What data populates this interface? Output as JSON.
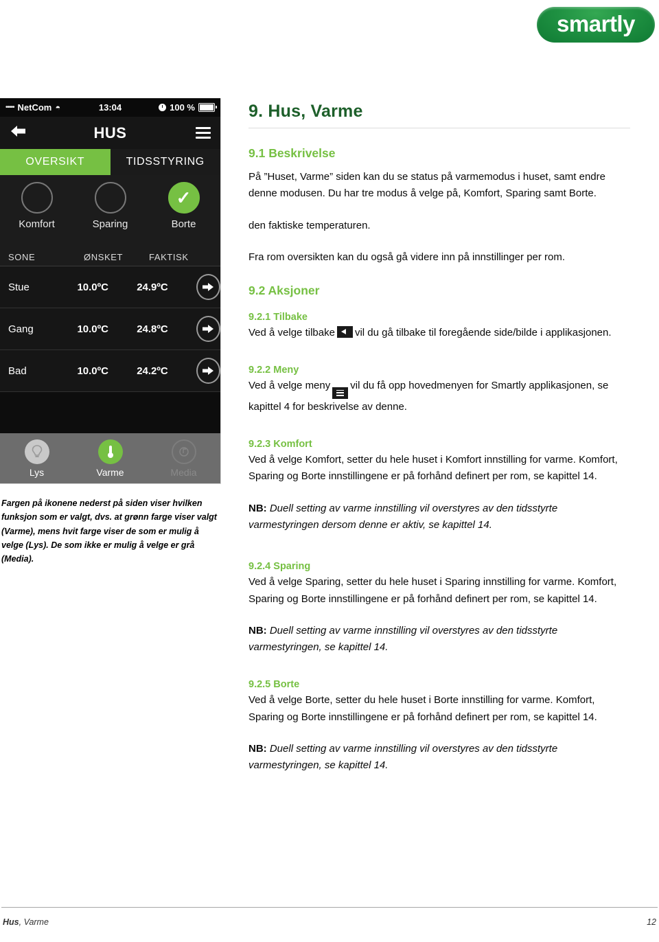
{
  "brand": {
    "logo_text": "smartly",
    "green": "#76c043",
    "dark_green": "#1d5f2a"
  },
  "phone": {
    "statusbar": {
      "carrier": "NetCom",
      "signal_dots": "•••••",
      "wifi_icon": "wifi-icon",
      "time": "13:04",
      "battery_percent": "100 %",
      "alarm_icon": "clock-icon"
    },
    "navbar": {
      "title": "HUS",
      "back_icon": "back-arrow-icon",
      "menu_icon": "hamburger-menu-icon"
    },
    "tabs": [
      {
        "label": "OVERSIKT",
        "active": true
      },
      {
        "label": "TIDSSTYRING",
        "active": false
      }
    ],
    "modes": [
      {
        "label": "Komfort",
        "selected": false
      },
      {
        "label": "Sparing",
        "selected": false
      },
      {
        "label": "Borte",
        "selected": true
      }
    ],
    "table": {
      "headers": [
        "SONE",
        "ØNSKET",
        "FAKTISK"
      ],
      "rows": [
        {
          "zone": "Stue",
          "desired": "10.0ºC",
          "actual": "24.9ºC"
        },
        {
          "zone": "Gang",
          "desired": "10.0ºC",
          "actual": "24.8ºC"
        },
        {
          "zone": "Bad",
          "desired": "10.0ºC",
          "actual": "24.2ºC"
        }
      ]
    },
    "tabbar": [
      {
        "label": "Lys",
        "icon": "lightbulb-icon",
        "state": "available"
      },
      {
        "label": "Varme",
        "icon": "thermometer-icon",
        "state": "selected"
      },
      {
        "label": "Media",
        "icon": "media-icon",
        "state": "disabled"
      }
    ]
  },
  "caption": "Fargen på ikonene nederst på siden viser hvilken funksjon som er valgt, dvs. at grønn farge viser valgt (Varme), mens hvit farge viser de som er mulig å velge (Lys). De som ikke er mulig å velge er grå (Media).",
  "doc": {
    "title": "9.  Hus, Varme",
    "s91": {
      "heading": "9.1  Beskrivelse",
      "p1": "På ”Huset, Varme” siden kan du se status på varmemodus i huset, samt endre denne modusen. Du har tre modus å velge på, Komfort, Sparing samt Borte.",
      "p2": "den faktiske temperaturen.",
      "p3": "Fra rom oversikten kan du også gå videre inn på innstillinger per rom."
    },
    "s92": {
      "heading": "9.2  Aksjoner",
      "tilbake": {
        "heading": "9.2.1  Tilbake",
        "text_before": "Ved å velge tilbake",
        "icon": "back-arrow-icon",
        "text_after": "vil du gå tilbake til foregående side/bilde i applikasjonen."
      },
      "meny": {
        "heading": "9.2.2  Meny",
        "text_before": "Ved å velge meny",
        "icon": "hamburger-menu-icon",
        "text_after": "vil du få opp hovedmenyen for Smartly applikasjonen, se kapittel 4 for beskrivelse av denne."
      },
      "komfort": {
        "heading": "9.2.3  Komfort",
        "p1": "Ved å velge Komfort, setter du hele huset i Komfort innstilling for varme. Komfort, Sparing og Borte innstillingene er på forhånd definert per rom, se kapittel 14.",
        "nb_label": "NB:",
        "nb_text": " Duell setting av varme innstilling vil overstyres av den tidsstyrte varmestyringen dersom denne er aktiv, se kapittel 14."
      },
      "sparing": {
        "heading": "9.2.4  Sparing",
        "p1": "Ved å velge Sparing, setter du hele huset i Sparing innstilling for varme. Komfort, Sparing og Borte innstillingene er på forhånd definert per rom, se kapittel 14.",
        "nb_label": "NB:",
        "nb_text": " Duell setting av varme innstilling vil overstyres av den tidsstyrte varmestyringen, se kapittel 14."
      },
      "borte": {
        "heading": "9.2.5  Borte",
        "p1": "Ved å velge Borte, setter du hele huset i Borte innstilling for varme. Komfort, Sparing og Borte innstillingene er på forhånd definert per rom, se kapittel 14.",
        "nb_label": "NB:",
        "nb_text": " Duell setting av varme innstilling vil overstyres av den tidsstyrte varmestyringen, se kapittel 14."
      }
    }
  },
  "footer": {
    "left_bold": "Hus",
    "left_rest": ", Varme",
    "page": "12"
  }
}
